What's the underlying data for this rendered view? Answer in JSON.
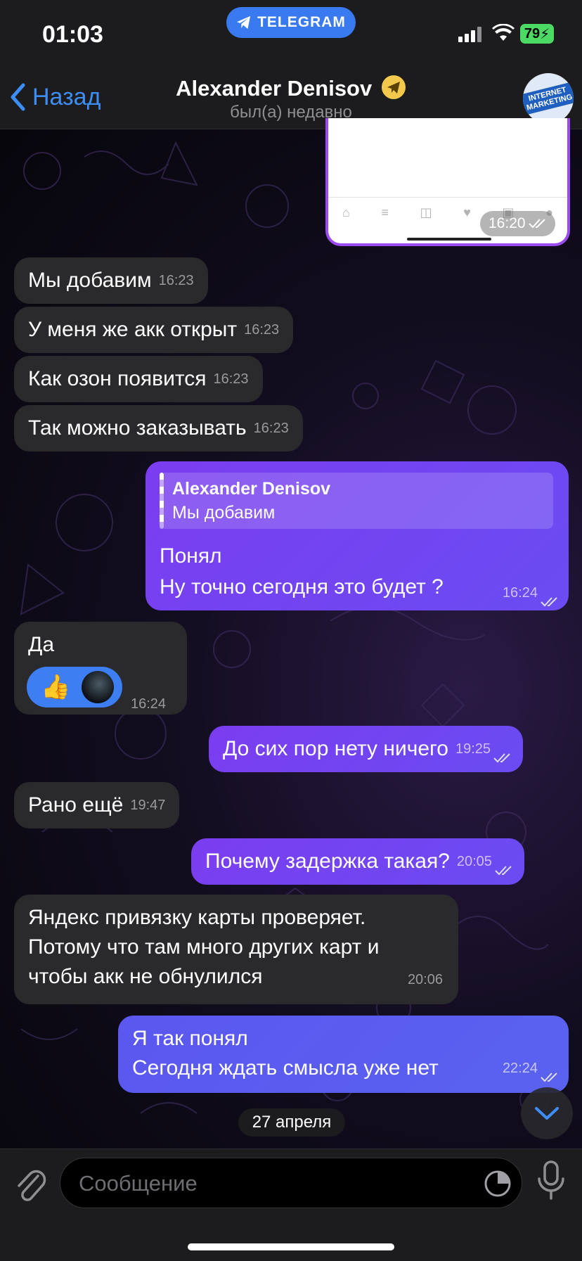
{
  "status": {
    "time": "01:03",
    "app_pill": "TELEGRAM",
    "battery": "79"
  },
  "header": {
    "back_label": "Назад",
    "contact_name": "Alexander Denisov",
    "last_seen": "был(а) недавно",
    "avatar_text": "INTERNET MARKETING"
  },
  "image_message": {
    "time": "16:20"
  },
  "messages": [
    {
      "dir": "in",
      "text": "Мы добавим",
      "time": "16:23"
    },
    {
      "dir": "in",
      "text": "У меня же акк открыт",
      "time": "16:23"
    },
    {
      "dir": "in",
      "text": "Как озон появится",
      "time": "16:23"
    },
    {
      "dir": "in",
      "text": "Так можно заказывать",
      "time": "16:23"
    },
    {
      "dir": "out",
      "reply_name": "Alexander Denisov",
      "reply_text": "Мы добавим",
      "line1": "Понял",
      "line2": "Ну точно сегодня это будет ?",
      "time": "16:24"
    },
    {
      "dir": "in",
      "text": "Да",
      "reaction": "👍",
      "time": "16:24"
    },
    {
      "dir": "out",
      "text": "До сих пор нету ничего",
      "time": "19:25"
    },
    {
      "dir": "in",
      "text": "Рано ещё",
      "time": "19:47"
    },
    {
      "dir": "out",
      "text": "Почему задержка такая?",
      "time": "20:05"
    },
    {
      "dir": "in",
      "line1": "Яндекс привязку карты проверяет.",
      "line2": "Потому что там много других карт и",
      "line3": "чтобы акк не обнулился",
      "time": "20:06"
    },
    {
      "dir": "out",
      "line1": "Я так понял",
      "line2": "Сегодня ждать смысла уже нет",
      "time": "22:24"
    }
  ],
  "date_separator": "27 апреля",
  "composer": {
    "placeholder": "Сообщение"
  },
  "colors": {
    "accent": "#3e8ef7",
    "outgoing": "#7b3df0",
    "incoming": "#2a2a2c"
  }
}
